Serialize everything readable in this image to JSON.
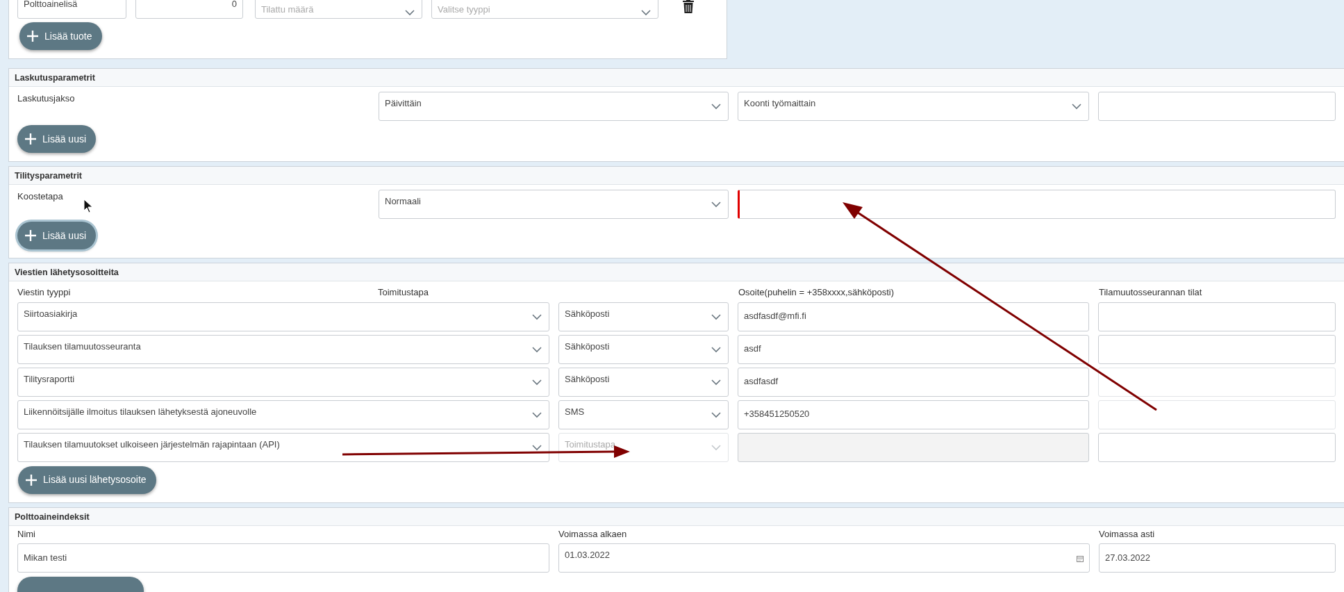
{
  "product_row": {
    "name": "Polttoainelisä",
    "quantity": "0",
    "unit_placeholder": "Tilattu määrä",
    "type_placeholder": "Valitse tyyppi"
  },
  "add_product_button": "Lisää tuote",
  "billing": {
    "title": "Laskutusparametrit",
    "label": "Laskutusjakso",
    "period": "Päivittäin",
    "grouping": "Koonti työmaittain",
    "add_button": "Lisää uusi",
    "add_button_focused": false
  },
  "settlement": {
    "title": "Tilitysparametrit",
    "label": "Koostetapa",
    "method": "Normaali",
    "extra_invalid": true,
    "add_button": "Lisää uusi",
    "add_button_focused": true
  },
  "messages": {
    "title": "Viestien lähetysosoitteita",
    "columns": [
      "Viestin tyyppi",
      "Toimitustapa",
      "Osoite(puhelin = +358xxxx,sähköposti)",
      "Tilamuutosseurannan tilat"
    ],
    "rows": [
      {
        "type": "Siirtoasiakirja",
        "delivery": "Sähköposti",
        "address": "asdfasdf@mfi.fi",
        "disabled": false,
        "status_disabled": false
      },
      {
        "type": "Tilauksen tilamuutosseuranta",
        "delivery": "Sähköposti",
        "address": "asdf",
        "disabled": false,
        "status_disabled": false
      },
      {
        "type": "Tilitysraportti",
        "delivery": "Sähköposti",
        "address": "asdfasdf",
        "disabled": false,
        "status_disabled": true
      },
      {
        "type": "Liikennöitsijälle ilmoitus tilauksen lähetyksestä ajoneuvolle",
        "delivery": "SMS",
        "address": "+358451250520",
        "disabled": false,
        "status_disabled": true
      },
      {
        "type": "Tilauksen tilamuutokset ulkoiseen järjestelmän rajapintaan (API)",
        "delivery_placeholder": "Toimitustapa",
        "disabled": true,
        "status_disabled": false
      }
    ],
    "add_button": "Lisää uusi lähetysosoite"
  },
  "fuel_indexes": {
    "title": "Polttoaineindeksit",
    "columns": [
      "Nimi",
      "Voimassa alkaen",
      "Voimassa asti"
    ],
    "rows": [
      {
        "name": "Mikan testi",
        "valid_from": "01.03.2022",
        "valid_to": "27.03.2022"
      }
    ]
  }
}
